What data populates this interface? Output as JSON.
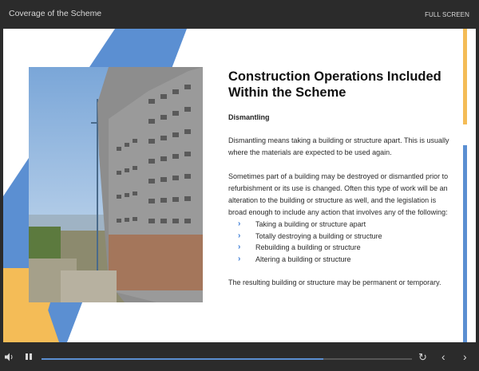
{
  "header": {
    "title": "Coverage of the Scheme",
    "fullscreen_label": "FULL SCREEN"
  },
  "slide": {
    "heading": "Construction Operations Included Within the Scheme",
    "subheading": "Dismantling",
    "paragraph1": "Dismantling means taking a building or structure apart. This is usually where the materials are expected to be used again.",
    "paragraph2": "Sometimes part of a building may be destroyed or dismantled prior to refurbishment or its use is changed. Often this type of work will be an alteration to the building or structure as well, and the legislation is broad enough to include any action that involves any of the following:",
    "bullets": [
      "Taking a building or structure apart",
      "Totally destroying a building or structure",
      "Rebuilding a building or structure",
      "Altering a building or structure"
    ],
    "paragraph3": "The resulting building or structure may be permanent or temporary.",
    "bullet_icon": "chevron-right-icon",
    "colors": {
      "accent_blue": "#5b8fd2",
      "accent_yellow": "#f4bc57",
      "bullet": "#3a7bd5"
    }
  },
  "player": {
    "progress_fraction": 0.76,
    "icons": [
      "volume-icon",
      "pause-icon",
      "replay-icon",
      "previous-icon",
      "next-icon"
    ]
  }
}
